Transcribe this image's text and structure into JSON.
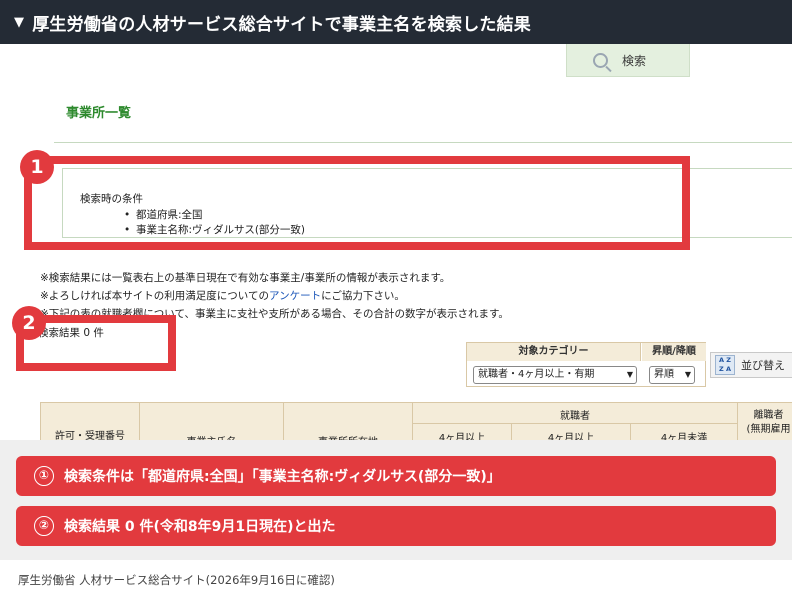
{
  "header": {
    "arrow": "▼",
    "title": "厚生労働省の人材サービス総合サイトで事業主名を検索した結果"
  },
  "search_button": {
    "label": "検索",
    "icon": "search-icon"
  },
  "section_title": "事業所一覧",
  "conditions": {
    "title": "検索時の条件",
    "items": [
      "都道府県:全国",
      "事業主名称:ヴィダルサス(部分一致)"
    ]
  },
  "notes": {
    "n1": "※検索結果には一覧表右上の基準日現在で有効な事業主/事業所の情報が表示されます。",
    "n2_pre": "※よろしければ本サイトの利用満足度についての",
    "n2_link": "アンケート",
    "n2_post": "にご協力下さい。",
    "n3": "※下記の表の就職者欄について、事業主に支社や支所がある場合、その合計の数字が表示されます。"
  },
  "result_text": "検索結果 0 件",
  "filters": {
    "category_header": "対象カテゴリー",
    "category_value": "就職者・4ヶ月以上・有期",
    "order_header": "昇順/降順",
    "order_value": "昇順",
    "sort_button": "並び替え"
  },
  "table_headers": {
    "permit": "許可・受理番号",
    "name": "事業主氏名",
    "location": "事業所所在地",
    "employed": "就職者",
    "over4_a": "4ヶ月以上",
    "over4_b": "4ヶ月以上",
    "under4": "4ヶ月未満",
    "leavers": "離職者",
    "leavers_sub": "(無期雇用"
  },
  "markers": {
    "m1": "1",
    "m2": "2"
  },
  "callouts": [
    {
      "num": "①",
      "text": "検索条件は「都道府県:全国」「事業主名称:ヴィダルサス(部分一致)」"
    },
    {
      "num": "②",
      "text": "検索結果 0 件(令和8年9月1日現在)と出た"
    }
  ],
  "footer": "厚生労働省 人材サービス総合サイト(2026年9月16日に確認)",
  "colors": {
    "header_bg": "#242b35",
    "accent_red": "#e23a3e",
    "section_green": "#2e8a2e",
    "link_blue": "#1a55b8"
  }
}
